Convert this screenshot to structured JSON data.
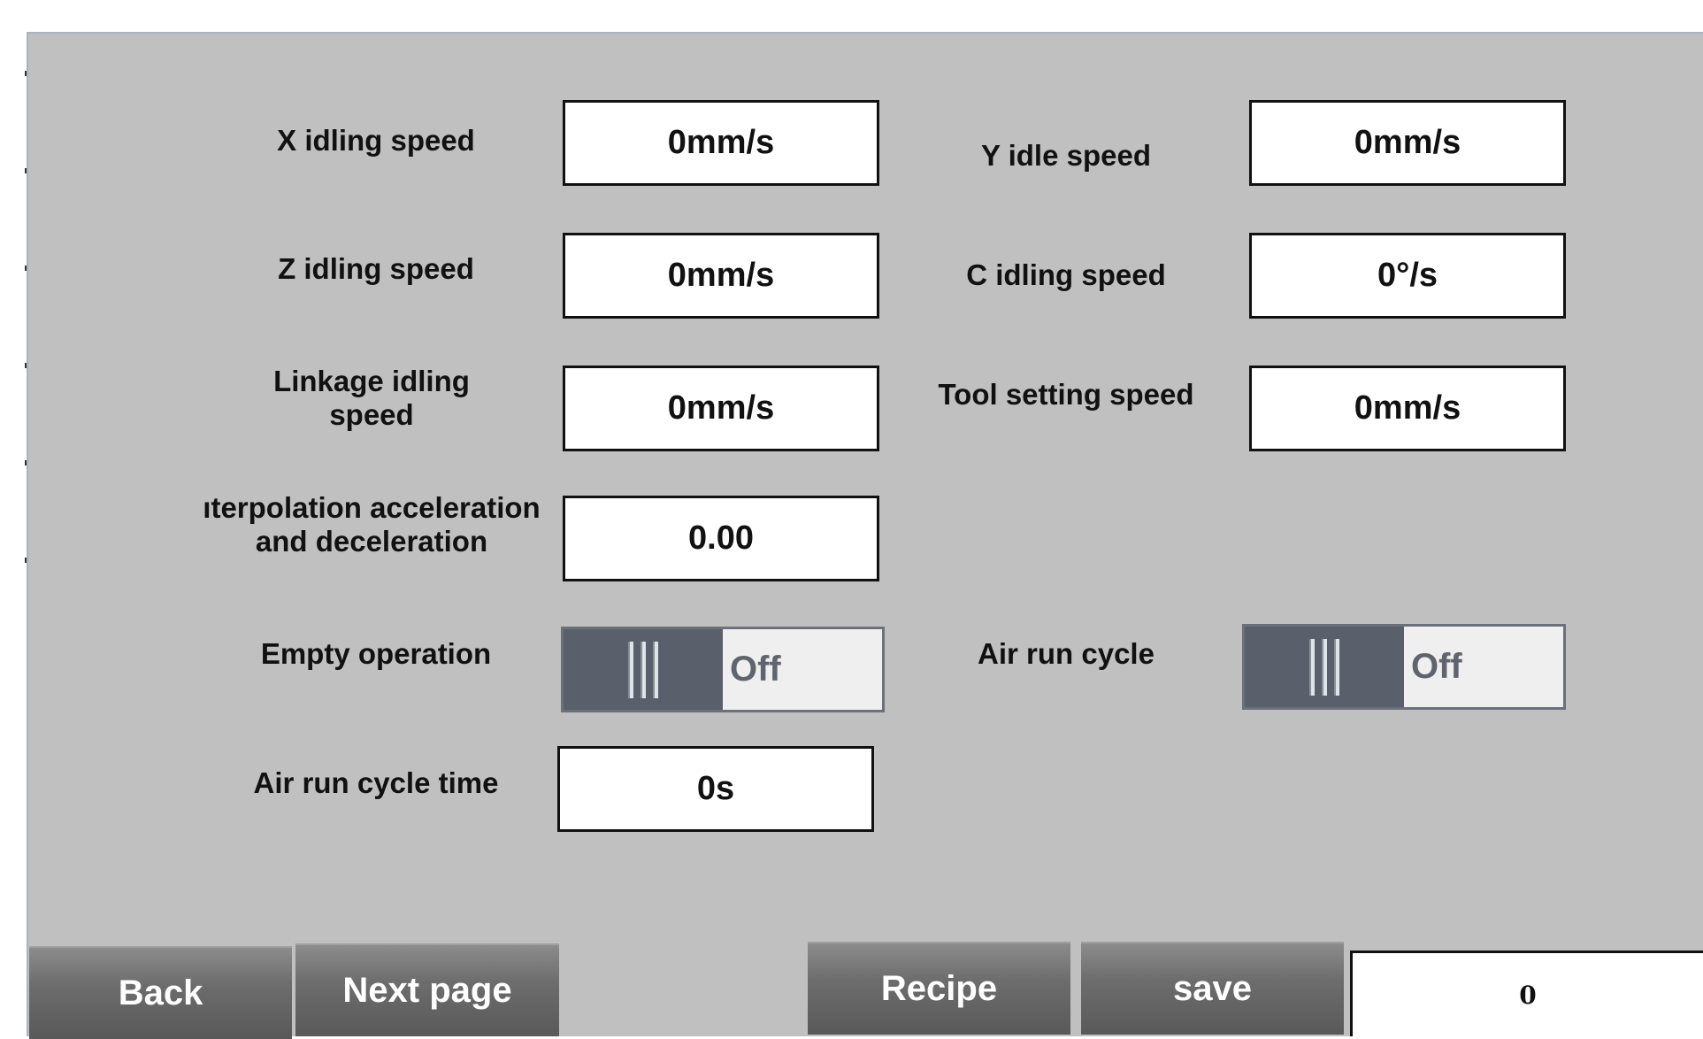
{
  "fields": {
    "x_idling_speed": {
      "label": "X idling speed",
      "value": "0mm/s"
    },
    "y_idle_speed": {
      "label": "Y idle speed",
      "value": "0mm/s"
    },
    "z_idling_speed": {
      "label": "Z idling speed",
      "value": "0mm/s"
    },
    "c_idling_speed": {
      "label": "C idling speed",
      "value": "0°/s"
    },
    "linkage_idling_speed": {
      "label": "Linkage idling speed",
      "value": "0mm/s"
    },
    "tool_setting_speed": {
      "label": "Tool setting speed",
      "value": "0mm/s"
    },
    "interpolation": {
      "label": "ıterpolation acceleration and deceleration",
      "value": "0.00"
    },
    "air_run_cycle_time": {
      "label": "Air run cycle time",
      "value": "0s"
    }
  },
  "toggles": {
    "empty_operation": {
      "label": "Empty operation",
      "state": "Off"
    },
    "air_run_cycle": {
      "label": "Air run cycle",
      "state": "Off"
    }
  },
  "footer": {
    "back": "Back",
    "next_page": "Next page",
    "recipe": "Recipe",
    "save": "save",
    "counter": "0"
  },
  "colors": {
    "panel_bg": "#c0c0c0",
    "toggle_knob": "#5a606b",
    "button_bg": "#6d6d6d"
  }
}
